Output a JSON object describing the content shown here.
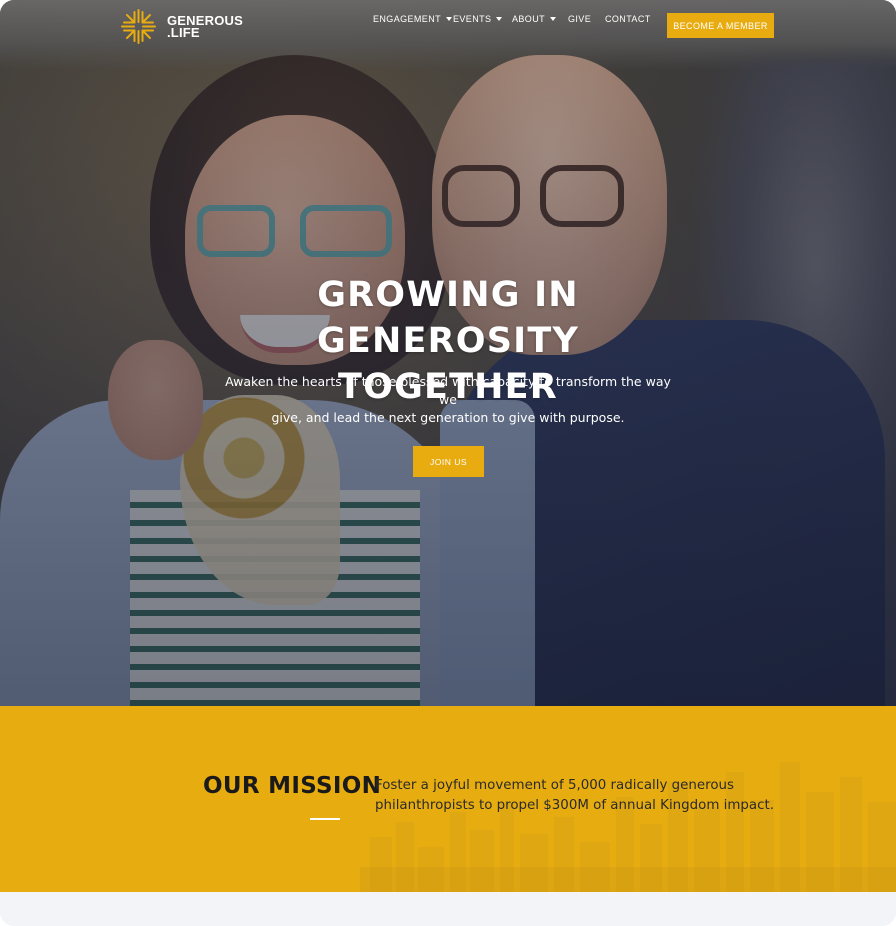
{
  "brand": {
    "logo_line1": "GENEROUS",
    "logo_line2": ".LIFE",
    "accent_color": "#e8ac10",
    "logo_icon": "sunburst-cross-icon"
  },
  "nav": {
    "items": [
      {
        "label": "ENGAGEMENT",
        "has_dropdown": true
      },
      {
        "label": "EVENTS",
        "has_dropdown": true
      },
      {
        "label": "ABOUT",
        "has_dropdown": true
      },
      {
        "label": "GIVE",
        "has_dropdown": false
      },
      {
        "label": "CONTACT",
        "has_dropdown": false
      }
    ],
    "cta_label": "BECOME A MEMBER"
  },
  "hero": {
    "title_line1": "GROWING IN GENEROSITY",
    "title_line2": "TOGETHER",
    "subtitle_line1": "Awaken the hearts of those blessed with capacity to transform the way we",
    "subtitle_line2": "give, and lead the next generation to give with purpose.",
    "button_label": "JOIN US"
  },
  "mission": {
    "heading": "OUR MISSION",
    "text_line1": "Foster a joyful movement of 5,000 radically generous",
    "text_line2": "philanthropists to propel $300M of annual Kingdom impact.",
    "background_color": "#e7ad10"
  }
}
